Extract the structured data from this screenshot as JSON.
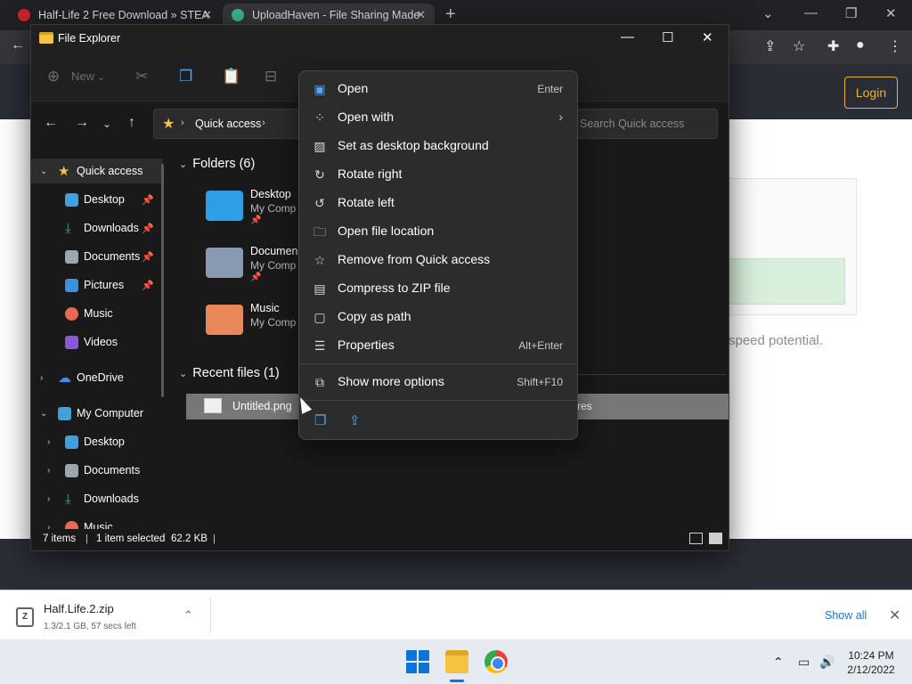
{
  "browser": {
    "tabs": [
      {
        "title": "Half-Life 2 Free Download » STEA",
        "favicon_color": "#c8232c"
      },
      {
        "title": "UploadHaven - File Sharing Made",
        "favicon_color": "#3bb58a"
      }
    ],
    "login_label": "Login",
    "page_text": "speed potential."
  },
  "explorer": {
    "title": "File Explorer",
    "cmd_new_label": "New",
    "address": {
      "crumb": "Quick access"
    },
    "search_placeholder": "Search Quick access",
    "nav": [
      {
        "label": "Quick access",
        "icon": "star-icon",
        "color": "#f5c242",
        "expander": "expanded",
        "selected": true
      },
      {
        "label": "Desktop",
        "icon": "desktop-icon",
        "color": "#3fa0e0",
        "pinned": true
      },
      {
        "label": "Downloads",
        "icon": "download-icon",
        "color": "#2fb36a",
        "pinned": true
      },
      {
        "label": "Documents",
        "icon": "document-icon",
        "color": "#9aa6b2",
        "pinned": true
      },
      {
        "label": "Pictures",
        "icon": "picture-icon",
        "color": "#3d8fe0",
        "pinned": true
      },
      {
        "label": "Music",
        "icon": "music-icon",
        "color": "#e86a55"
      },
      {
        "label": "Videos",
        "icon": "video-icon",
        "color": "#8a5ad6"
      },
      {
        "label": "OneDrive",
        "icon": "cloud-icon",
        "color": "#3d8fe0",
        "expander": "collapsed"
      },
      {
        "label": "My Computer",
        "icon": "computer-icon",
        "color": "#3fa0e0",
        "expander": "expanded"
      },
      {
        "label": "Desktop",
        "icon": "desktop-icon",
        "color": "#3fa0e0",
        "expander": "collapsed"
      },
      {
        "label": "Documents",
        "icon": "document-icon",
        "color": "#9aa6b2",
        "expander": "collapsed"
      },
      {
        "label": "Downloads",
        "icon": "download-icon",
        "color": "#2fb36a",
        "expander": "collapsed"
      },
      {
        "label": "Music",
        "icon": "music-icon",
        "color": "#e86a55",
        "expander": "collapsed"
      }
    ],
    "folders_header": "Folders (6)",
    "folders": [
      {
        "name": "Desktop",
        "location": "My Comp",
        "icon": "desktop-folder-icon",
        "color": "#2f9ee8"
      },
      {
        "name": "Documen",
        "location": "My Comp",
        "icon": "documents-folder-icon",
        "color": "#8a9ab0"
      },
      {
        "name": "Music",
        "location": "My Comp",
        "icon": "music-folder-icon",
        "color": "#e8875a"
      }
    ],
    "recent_header": "Recent files (1)",
    "recent_files": [
      {
        "name": "Untitled.png",
        "location": "res"
      }
    ],
    "status": {
      "items": "7 items",
      "selected": "1 item selected",
      "size": "62.2 KB"
    }
  },
  "context_menu": {
    "items": [
      {
        "label": "Open",
        "icon": "image-icon",
        "shortcut": "Enter"
      },
      {
        "label": "Open with",
        "icon": "open-with-icon",
        "submenu": true
      },
      {
        "label": "Set as desktop background",
        "icon": "wallpaper-icon"
      },
      {
        "label": "Rotate right",
        "icon": "rotate-right-icon"
      },
      {
        "label": "Rotate left",
        "icon": "rotate-left-icon"
      },
      {
        "label": "Open file location",
        "icon": "folder-icon"
      },
      {
        "label": "Remove from Quick access",
        "icon": "unpin-star-icon"
      },
      {
        "label": "Compress to ZIP file",
        "icon": "zip-icon"
      },
      {
        "label": "Copy as path",
        "icon": "copy-path-icon"
      },
      {
        "label": "Properties",
        "icon": "properties-icon",
        "shortcut": "Alt+Enter"
      },
      {
        "label": "Show more options",
        "icon": "more-options-icon",
        "shortcut": "Shift+F10"
      }
    ],
    "footer_icons": [
      "copy-icon",
      "share-icon"
    ]
  },
  "download_bar": {
    "filename": "Half.Life.2.zip",
    "status": "1.3/2.1 GB, 57 secs left",
    "show_all": "Show all"
  },
  "taskbar": {
    "time": "10:24 PM",
    "date": "2/12/2022"
  }
}
